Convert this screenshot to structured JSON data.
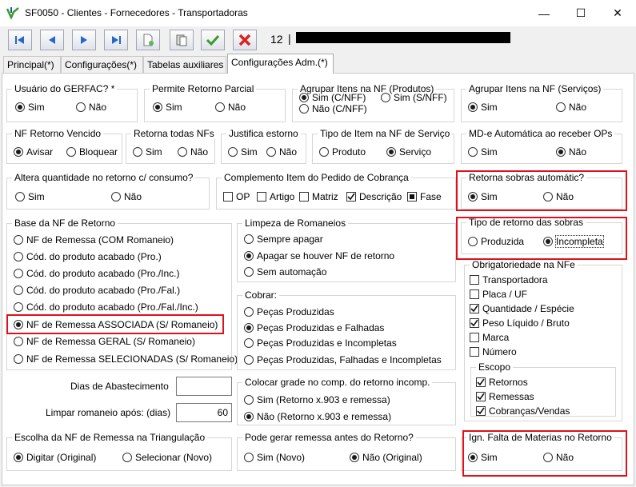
{
  "window": {
    "title": "SF0050 - Clientes - Fornecedores - Transportadoras",
    "minimize": "—",
    "maximize": "☐",
    "close": "✕"
  },
  "toolbar": {
    "record_number": "12",
    "record_separator": "|"
  },
  "tabs": [
    {
      "label": "Principal(*)"
    },
    {
      "label": "Configurações(*)"
    },
    {
      "label": "Tabelas auxiliares"
    },
    {
      "label": "Configurações Adm.(*)"
    }
  ],
  "groups": {
    "usuario_gerfac": {
      "title": "Usuário do GERFAC? *",
      "opts": [
        "Sim",
        "Não"
      ],
      "selected": "Sim"
    },
    "permite_retorno": {
      "title": "Permite Retorno Parcial",
      "opts": [
        "Sim",
        "Não"
      ],
      "selected": "Sim"
    },
    "agrupar_produtos": {
      "title": "Agrupar Itens na NF (Produtos)",
      "opts": [
        "Sim (C/NFF)",
        "Sim (S/NFF)",
        "Não (C/NFF)"
      ],
      "selected": "Sim (C/NFF)"
    },
    "agrupar_servicos": {
      "title": "Agrupar Itens na NF (Serviços)",
      "opts": [
        "Sim",
        "Não"
      ],
      "selected": "Sim"
    },
    "nf_retorno_vencido": {
      "title": "NF Retorno Vencido",
      "opts": [
        "Avisar",
        "Bloquear"
      ],
      "selected": "Avisar"
    },
    "retorna_todas": {
      "title": "Retorna todas NFs",
      "opts": [
        "Sim",
        "Não"
      ],
      "selected": ""
    },
    "justifica_estorno": {
      "title": "Justifica estorno",
      "opts": [
        "Sim",
        "Não"
      ],
      "selected": ""
    },
    "tipo_item_nf": {
      "title": "Tipo de Item na NF de Serviço",
      "opts": [
        "Produto",
        "Serviço"
      ],
      "selected": "Serviço"
    },
    "mde_automatica": {
      "title": "MD-e Automática ao receber OPs",
      "opts": [
        "Sim",
        "Não"
      ],
      "selected": "Não"
    },
    "altera_quantidade": {
      "title": "Altera quantidade no retorno c/ consumo?",
      "opts": [
        "Sim",
        "Não"
      ],
      "selected": ""
    },
    "complemento_item": {
      "title": "Complemento Item do Pedido de Cobrança",
      "opts": [
        "OP",
        "Artigo",
        "Matriz",
        "Descrição",
        "Fase"
      ],
      "checked": [
        "Descrição"
      ],
      "filled": [
        "Fase"
      ]
    },
    "retorna_sobras": {
      "title": "Retorna sobras automátic?",
      "opts": [
        "Sim",
        "Não"
      ],
      "selected": "Sim"
    },
    "tipo_retorno_sobras": {
      "title": "Tipo de retorno das sobras",
      "opts": [
        "Produzida",
        "Incompleta"
      ],
      "selected": "Incompleta"
    },
    "base_nf": {
      "title": "Base da NF de Retorno",
      "opts": [
        "NF de Remessa (COM Romaneio)",
        "Cód. do produto acabado (Pro.)",
        "Cód. do produto acabado (Pro./Inc.)",
        "Cód. do produto acabado (Pro./Fal.)",
        "Cód. do produto acabado (Pro./Fal./Inc.)",
        "NF de Remessa ASSOCIADA (S/ Romaneio)",
        "NF de Remessa GERAL (S/ Romaneio)",
        "NF de Remessa SELECIONADAS (S/ Romaneio)"
      ],
      "selected": "NF de Remessa ASSOCIADA (S/ Romaneio)"
    },
    "limpeza_romaneios": {
      "title": "Limpeza de Romaneios",
      "opts": [
        "Sempre apagar",
        "Apagar se houver NF de retorno",
        "Sem automação"
      ],
      "selected": "Apagar se houver NF de retorno"
    },
    "cobrar": {
      "title": "Cobrar:",
      "opts": [
        "Peças Produzidas",
        "Peças Produzidas e Falhadas",
        "Peças Produzidas e Incompletas",
        "Peças Produzidas, Falhadas e Incompletas"
      ],
      "selected": "Peças Produzidas e Falhadas"
    },
    "obrigatoriedade": {
      "title": "Obrigatoriedade na NFe",
      "opts": [
        "Transportadora",
        "Placa / UF",
        "Quantidade / Espécie",
        "Peso Líquido / Bruto",
        "Marca",
        "Número"
      ],
      "checked": [
        "Quantidade / Espécie",
        "Peso Líquido / Bruto"
      ]
    },
    "escopo": {
      "title": "Escopo",
      "opts": [
        "Retornos",
        "Remessas",
        "Cobranças/Vendas"
      ],
      "checked": [
        "Retornos",
        "Remessas",
        "Cobranças/Vendas"
      ]
    },
    "colocar_grade": {
      "title": "Colocar grade no comp. do retorno incomp.",
      "opts": [
        "Sim (Retorno x.903 e remessa)",
        "Não (Retorno x.903 e remessa)"
      ],
      "selected": "Não (Retorno x.903 e remessa)"
    },
    "escolha_nf_triangulacao": {
      "title": "Escolha da NF de Remessa na Triangulação",
      "opts": [
        "Digitar (Original)",
        "Selecionar (Novo)"
      ],
      "selected": "Digitar (Original)"
    },
    "pode_gerar_remessa": {
      "title": "Pode gerar remessa antes do Retorno?",
      "opts": [
        "Sim (Novo)",
        "Não (Original)"
      ],
      "selected": "Não (Original)"
    },
    "ign_falta_materias": {
      "title": "Ign. Falta de Materias no Retorno",
      "opts": [
        "Sim",
        "Não"
      ],
      "selected": "Sim"
    }
  },
  "fields": {
    "dias_abastecimento": {
      "label": "Dias de Abastecimento",
      "value": ""
    },
    "limpar_romaneio": {
      "label": "Limpar romaneio após: (dias)",
      "value": "60"
    }
  },
  "colors": {
    "highlight": "#e0101a",
    "accent": "#1a6fd1"
  }
}
